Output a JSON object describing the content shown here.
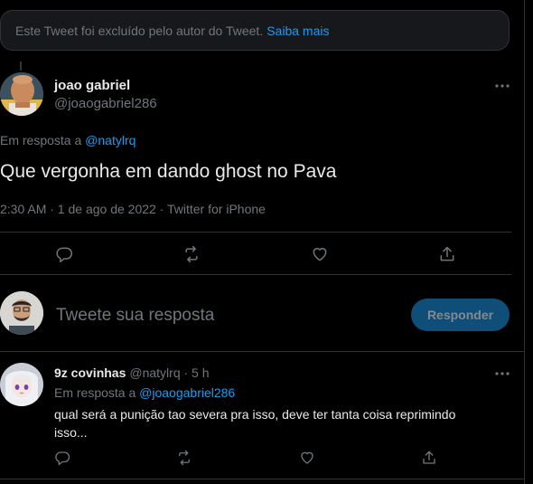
{
  "deleted_notice": {
    "text": "Este Tweet foi excluído pelo autor do Tweet.",
    "link": "Saiba mais"
  },
  "main_tweet": {
    "name": "joao gabriel",
    "handle": "@joaogabriel286",
    "reply_prefix": "Em resposta a",
    "reply_mention": "@natylrq",
    "text": "Que vergonha em dando ghost no Pava",
    "meta": "2:30 AM · 1 de ago de 2022 · Twitter for iPhone",
    "actions": [
      "reply-icon",
      "retweet-icon",
      "like-icon",
      "share-icon"
    ]
  },
  "composer": {
    "placeholder": "Tweete sua resposta",
    "button": "Responder"
  },
  "reply_tweet": {
    "name": "9z covinhas",
    "handle": "@natylrq · 5 h",
    "reply_prefix": "Em resposta a",
    "reply_mention": "@joaogabriel286",
    "text": "qual será a punição tao severa pra isso, deve ter tanta coisa reprimindo isso...",
    "actions": [
      "reply-icon",
      "retweet-icon",
      "like-icon",
      "share-icon"
    ]
  },
  "colors": {
    "background": "#000000",
    "text": "#e7e9ea",
    "secondary": "#71767b",
    "accent": "#1d9bf0",
    "border": "#2f3336",
    "button_disabled": "#0f4e78"
  }
}
